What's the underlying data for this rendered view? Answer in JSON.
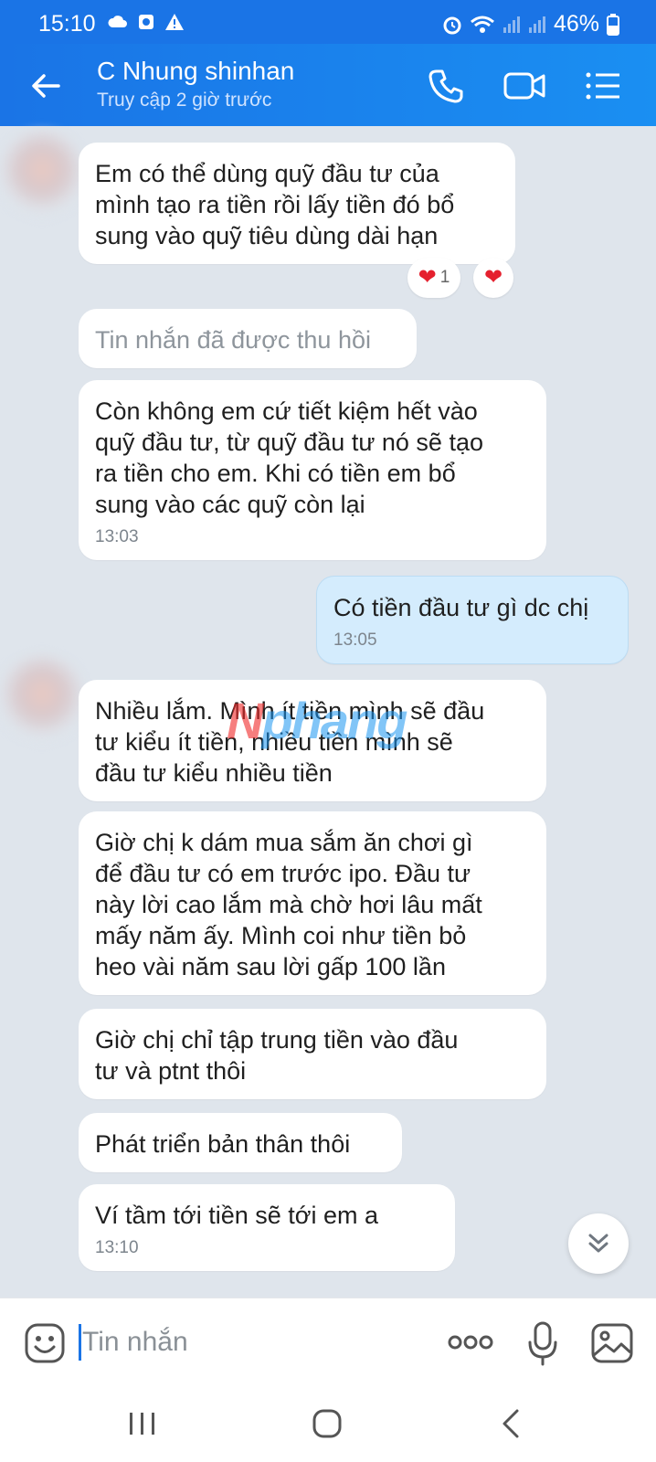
{
  "status_bar": {
    "time": "15:10",
    "battery": "46%",
    "icons_left": [
      "cloud-icon",
      "notification-box-icon",
      "warning-icon"
    ],
    "icons_right": [
      "alarm-icon",
      "wifi-icon",
      "signal-icon",
      "signal-icon",
      "battery-icon"
    ]
  },
  "header": {
    "contact_name": "C Nhung shinhan",
    "contact_status": "Truy cập 2 giờ trước",
    "actions": [
      "phone-icon",
      "video-call-icon",
      "menu-list-icon"
    ]
  },
  "messages": [
    {
      "direction": "in",
      "lines": [
        "Em có thể dùng quỹ đầu tư của",
        "mình tạo ra tiền rồi lấy tiền đó bổ",
        "sung vào quỹ tiêu dùng dài hạn"
      ],
      "reactions": [
        {
          "emoji": "❤",
          "count": "1"
        },
        {
          "emoji": "❤",
          "count": ""
        }
      ]
    },
    {
      "direction": "in",
      "recalled": true,
      "lines": [
        "Tin nhắn đã được thu hồi"
      ]
    },
    {
      "direction": "in",
      "lines": [
        "Còn không em cứ tiết kiệm hết vào",
        "quỹ đầu tư,  từ quỹ đầu tư nó sẽ tạo",
        "ra tiền cho em. Khi có tiền em bổ",
        "sung vào các quỹ còn lại"
      ],
      "time": "13:03"
    },
    {
      "direction": "out",
      "lines": [
        "Có tiền đầu tư gì dc chị"
      ],
      "time": "13:05"
    },
    {
      "direction": "in",
      "lines": [
        "Nhiều lắm.  Mình ít tiền mình sẽ đầu",
        "tư kiểu ít tiền,  nhiều tiền mình sẽ",
        "đầu tư kiểu nhiều tiền"
      ]
    },
    {
      "direction": "in",
      "lines": [
        "Giờ  chị k dám mua sắm ăn chơi gì",
        "để đầu tư có em trước ipo.  Đầu tư",
        "này lời cao lắm mà chờ hơi lâu  mất",
        "mấy năm ấy.  Mình  coi như tiền bỏ",
        "heo  vài  năm  sau lời  gấp 100 lần"
      ]
    },
    {
      "direction": "in",
      "lines": [
        "Giờ  chị  chỉ  tập trung tiền vào  đầu",
        "tư  và  ptnt thôi"
      ]
    },
    {
      "direction": "in",
      "lines": [
        "Phát triển bản thân thôi"
      ]
    },
    {
      "direction": "in",
      "lines": [
        "Ví  tầm tới  tiền  sẽ  tới  em a"
      ],
      "time": "13:10"
    }
  ],
  "watermark": {
    "first": "N",
    "rest": "phang"
  },
  "input": {
    "placeholder": "Tin nhắn"
  },
  "input_actions": [
    "emoji-icon",
    "more-options-icon",
    "microphone-icon",
    "image-icon"
  ],
  "nav_bar": [
    "recent-apps-icon",
    "home-icon",
    "back-icon"
  ]
}
